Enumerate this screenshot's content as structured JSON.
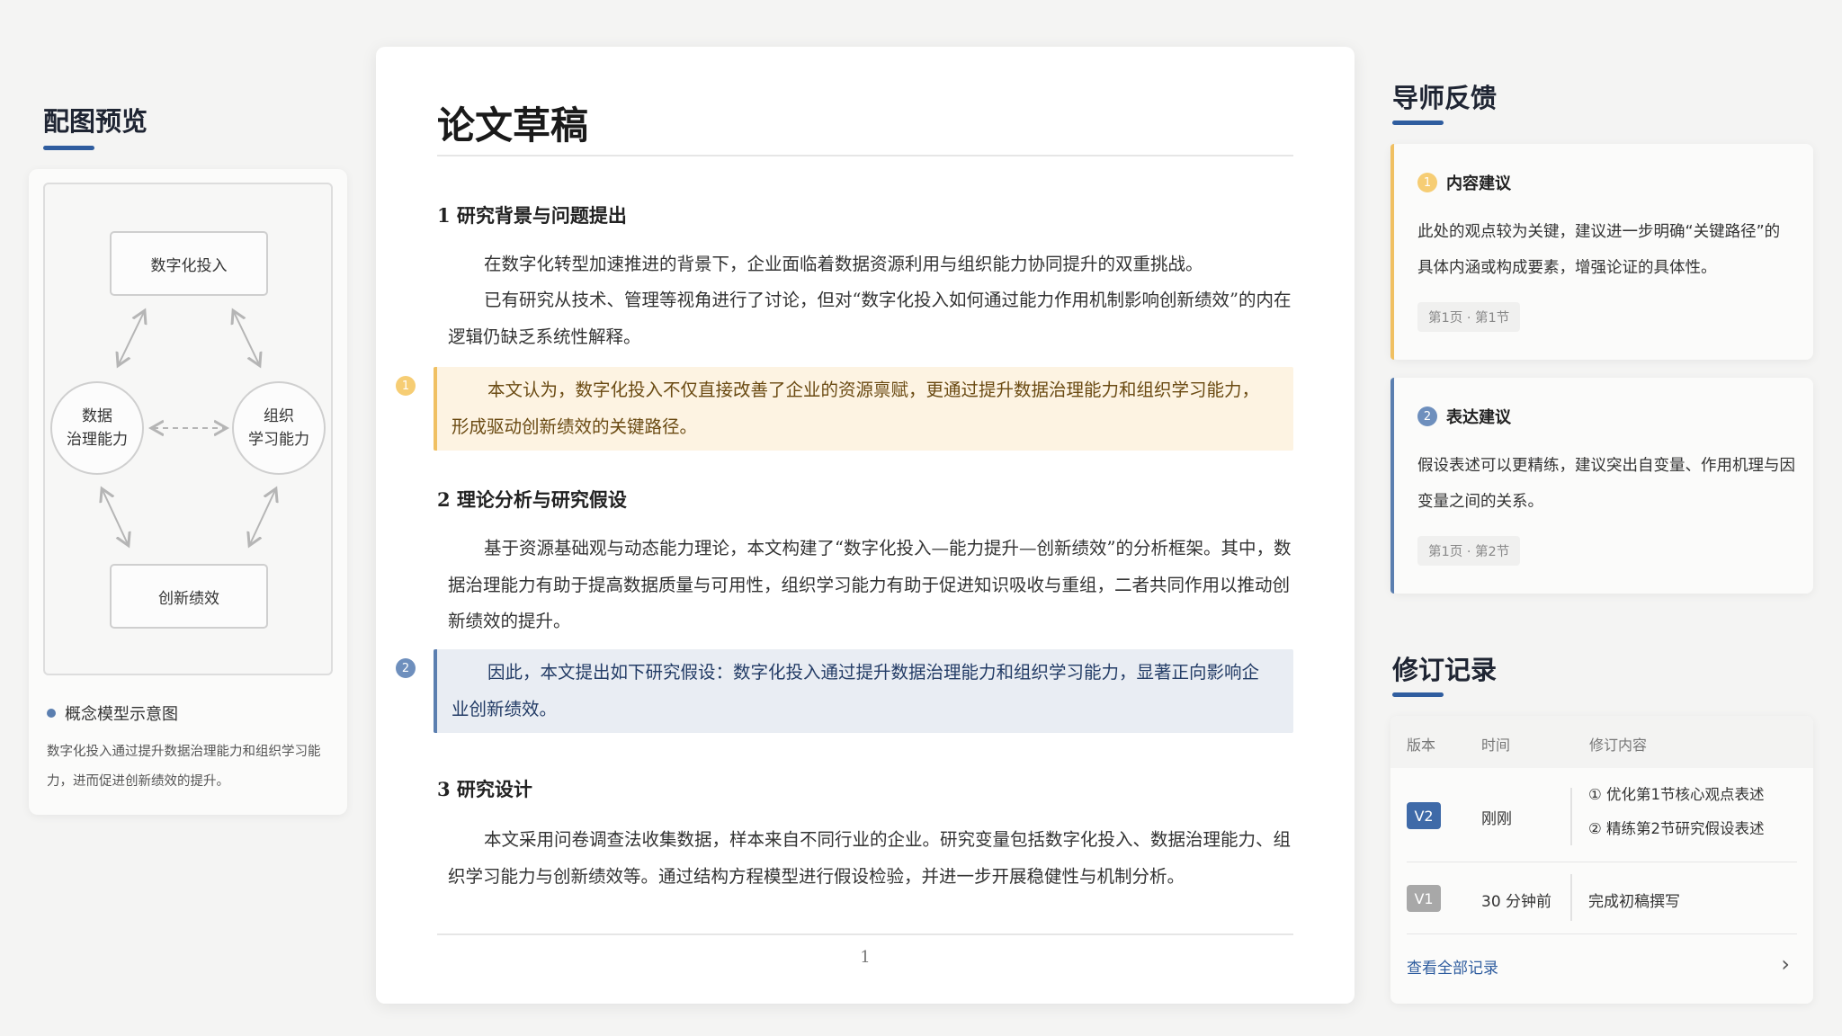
{
  "left": {
    "title": "配图预览",
    "diagram": {
      "top_node": "数字化投入",
      "left_node_line1": "数据",
      "left_node_line2": "治理能力",
      "right_node_line1": "组织",
      "right_node_line2": "学习能力",
      "bottom_node": "创新绩效"
    },
    "caption": "概念模型示意图",
    "description": "数字化投入通过提升数据治理能力和组织学习能力，进而促进创新绩效的提升。"
  },
  "doc": {
    "title": "论文草稿",
    "section1": {
      "heading": "1 研究背景与问题提出",
      "para1": "在数字化转型加速推进的背景下，企业面临着数据资源利用与组织能力协同提升的双重挑战。",
      "para2": "已有研究从技术、管理等视角进行了讨论，但对“数字化投入如何通过能力作用机制影响创新绩效”的内在逻辑仍缺乏系统性解释。",
      "highlight": "本文认为，数字化投入不仅直接改善了企业的资源禀赋，更通过提升数据治理能力和组织学习能力，形成驱动创新绩效的关键路径。",
      "marker": "1"
    },
    "section2": {
      "heading": "2 理论分析与研究假设",
      "para": "基于资源基础观与动态能力理论，本文构建了“数字化投入—能力提升—创新绩效”的分析框架。其中，数据治理能力有助于提高数据质量与可用性，组织学习能力有助于促进知识吸收与重组，二者共同作用以推动创新绩效的提升。",
      "highlight": "因此，本文提出如下研究假设：数字化投入通过提升数据治理能力和组织学习能力，显著正向影响企业创新绩效。",
      "marker": "2"
    },
    "section3": {
      "heading": "3 研究设计",
      "para": "本文采用问卷调查法收集数据，样本来自不同行业的企业。研究变量包括数字化投入、数据治理能力、组织学习能力与创新绩效等。通过结构方程模型进行假设检验，并进一步开展稳健性与机制分析。"
    },
    "page_number": "1"
  },
  "feedback": {
    "title": "导师反馈",
    "items": [
      {
        "marker": "1",
        "heading": "内容建议",
        "body": "此处的观点较为关键，建议进一步明确“关键路径”的具体内涵或构成要素，增强论证的具体性。",
        "location": "第1页 · 第1节",
        "color": "#f0c062"
      },
      {
        "marker": "2",
        "heading": "表达建议",
        "body": "假设表述可以更精练，建议突出自变量、作用机理与因变量之间的关系。",
        "location": "第1页 · 第2节",
        "color": "#5b7fb0"
      }
    ]
  },
  "revisions": {
    "title": "修订记录",
    "columns": {
      "version": "版本",
      "time": "时间",
      "content": "修订内容"
    },
    "rows": [
      {
        "version": "V2",
        "time": "刚刚",
        "content_line1": "① 优化第1节核心观点表述",
        "content_line2": "② 精练第2节研究假设表述",
        "badge_color": "#3f6aa8"
      },
      {
        "version": "V1",
        "time": "30 分钟前",
        "content_line1": "完成初稿撰写",
        "badge_color": "#a8a8a8"
      }
    ],
    "view_all": "查看全部记录"
  }
}
